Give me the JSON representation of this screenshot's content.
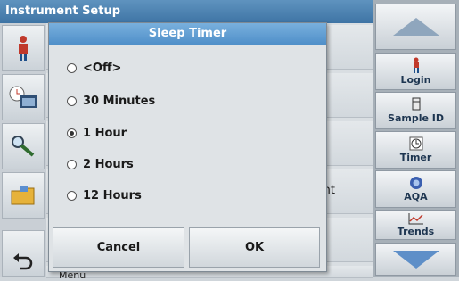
{
  "background": {
    "window_title": "Instrument Setup",
    "peek_right_text": "nt",
    "peek_bottom_text": "Menu"
  },
  "dialog": {
    "title": "Sleep Timer",
    "options": [
      {
        "label": "<Off>",
        "selected": false
      },
      {
        "label": "30 Minutes",
        "selected": false
      },
      {
        "label": "1 Hour",
        "selected": true
      },
      {
        "label": "2 Hours",
        "selected": false
      },
      {
        "label": "12 Hours",
        "selected": false
      }
    ],
    "cancel_label": "Cancel",
    "ok_label": "OK"
  },
  "right_panel": {
    "login_label": "Login",
    "sample_id_label": "Sample ID",
    "timer_label": "Timer",
    "aqa_label": "AQA",
    "trends_label": "Trends"
  },
  "colors": {
    "title_bar": "#4f8fc9",
    "scroll_down_arrow": "#5e8fc8",
    "scroll_up_arrow": "#8fa6bd"
  }
}
